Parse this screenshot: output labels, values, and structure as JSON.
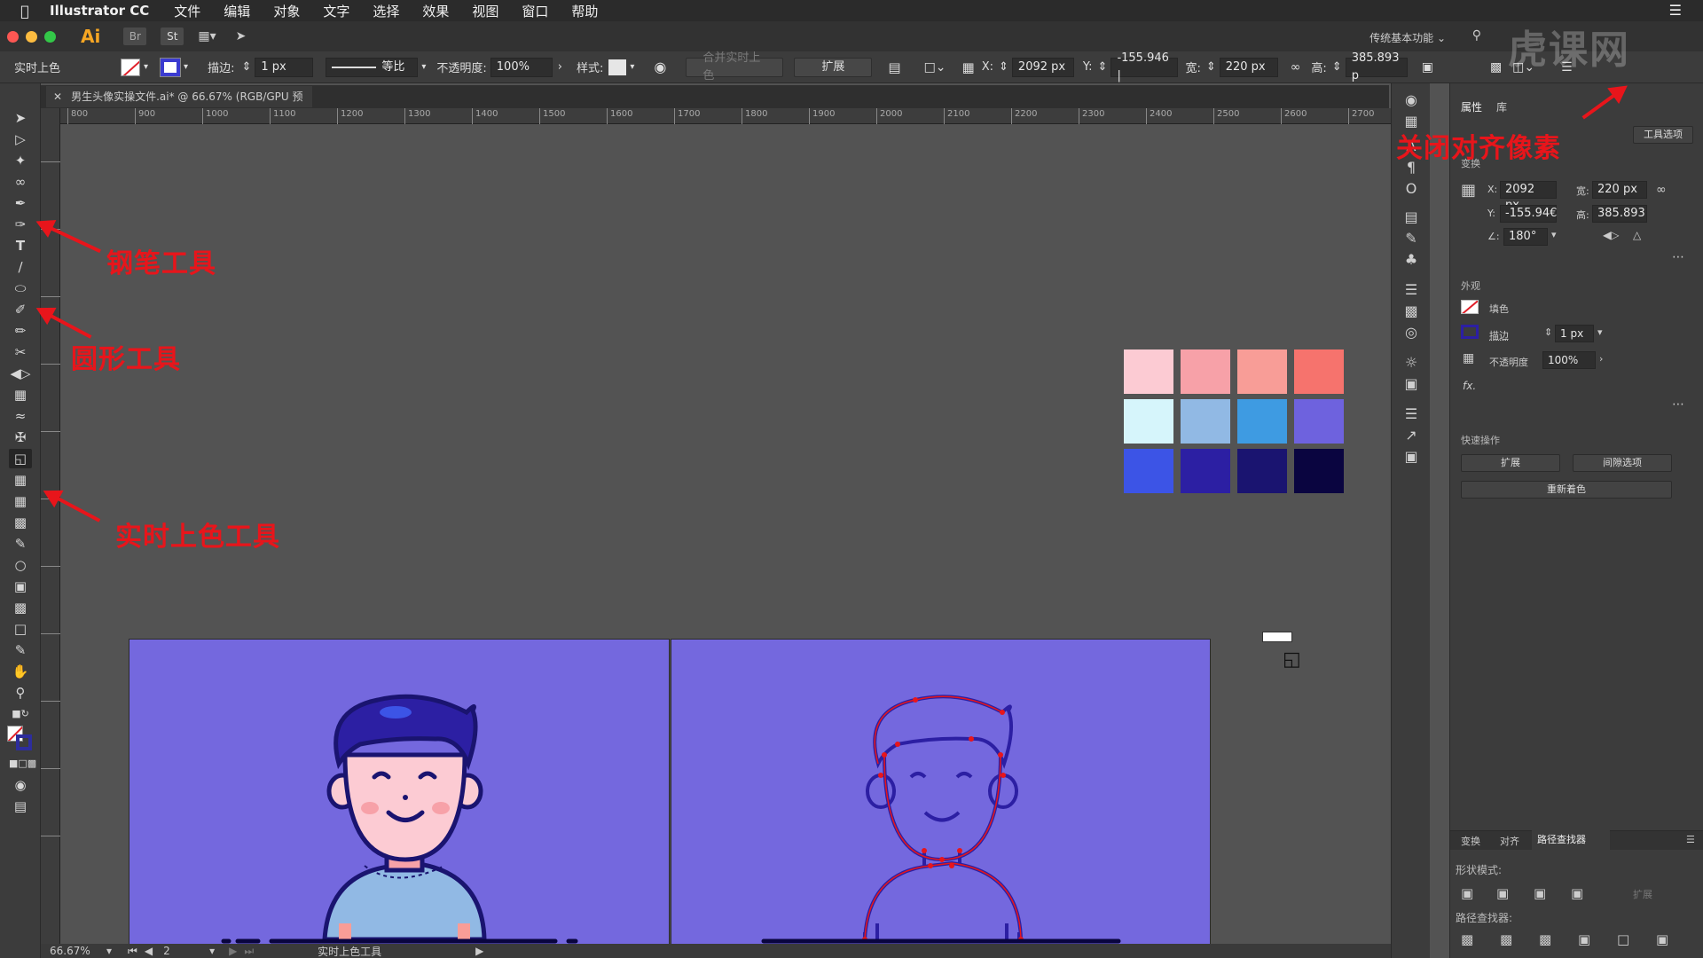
{
  "menubar": {
    "app_name": "Illustrator CC",
    "items": [
      "文件",
      "编辑",
      "对象",
      "文字",
      "选择",
      "效果",
      "视图",
      "窗口",
      "帮助"
    ]
  },
  "titlebar": {
    "logo": "Ai",
    "bridge": "Br",
    "stock": "St",
    "workspace": "传统基本功能"
  },
  "controlbar": {
    "mode_label": "实时上色",
    "stroke_label": "描边:",
    "stroke_value": "1 px",
    "profile_label": "等比",
    "opacity_label": "不透明度:",
    "opacity_value": "100%",
    "style_label": "样式:",
    "merge_button": "合并实时上色",
    "expand_button": "扩展",
    "x_label": "X:",
    "x_value": "2092 px",
    "y_label": "Y:",
    "y_value": "-155.946 |",
    "w_label": "宽:",
    "w_value": "220 px",
    "h_label": "高:",
    "h_value": "385.893 p"
  },
  "document": {
    "tab_title": "男生头像实操文件.ai* @ 66.67% (RGB/GPU 预览)"
  },
  "ruler": {
    "ticks": [
      "800",
      "900",
      "1000",
      "1100",
      "1200",
      "1300",
      "1400",
      "1500",
      "1600",
      "1700",
      "1800",
      "1900",
      "2000",
      "2100",
      "2200",
      "2300",
      "2400",
      "2500",
      "2600",
      "2700"
    ]
  },
  "status": {
    "zoom": "66.67%",
    "page": "2",
    "tool_name": "实时上色工具"
  },
  "annotations": {
    "pen_tool": "钢笔工具",
    "ellipse_tool": "圆形工具",
    "live_paint_tool": "实时上色工具",
    "snap_pixel": "关闭对齐像素"
  },
  "swatches": {
    "colors": [
      "#fccbd3",
      "#f7a1a8",
      "#f89d97",
      "#f6736d",
      "#d6f5fb",
      "#91b9e4",
      "#3e9be2",
      "#6e62de",
      "#3c54e6",
      "#2c1fa3",
      "#1a1470",
      "#0a0540"
    ]
  },
  "props": {
    "tab_properties": "属性",
    "tab_library": "库",
    "tool_options_button": "工具选项",
    "transform_title": "变换",
    "x_label": "X:",
    "x_value": "2092 px",
    "y_label": "Y:",
    "y_value": "-155.94€",
    "w_label": "宽:",
    "w_value": "220 px",
    "h_label": "高:",
    "h_value": "385.893",
    "angle_label": "∠:",
    "angle_value": "180°",
    "appearance_title": "外观",
    "fill_label": "填色",
    "stroke_label": "描边",
    "stroke_value": "1 px",
    "opacity_label": "不透明度",
    "opacity_value": "100%",
    "fx_label": "fx.",
    "quick_actions_title": "快速操作",
    "expand_button": "扩展",
    "gap_options_button": "间隙选项",
    "recolor_button": "重新着色",
    "bottom_tabs": [
      "变换",
      "对齐",
      "路径查找器"
    ],
    "shape_modes_title": "形状模式:",
    "shape_expand_button": "扩展",
    "pathfinder_title": "路径查找器:"
  },
  "watermark": "虎课网"
}
